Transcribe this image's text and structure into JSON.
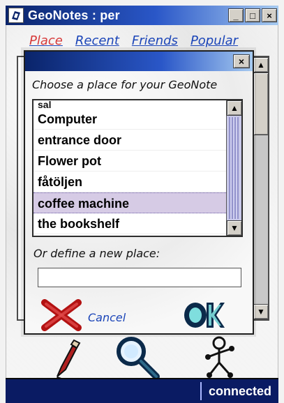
{
  "window": {
    "title": "GeoNotes : per",
    "controls": {
      "minimize": "_",
      "maximize": "□",
      "close": "×"
    }
  },
  "tabs": [
    {
      "label": "Place",
      "active": true
    },
    {
      "label": "Recent",
      "active": false
    },
    {
      "label": "Friends",
      "active": false
    },
    {
      "label": "Popular",
      "active": false
    }
  ],
  "dialog": {
    "close_label": "×",
    "prompt": "Choose a place for your GeoNote",
    "places": [
      {
        "label": "sal",
        "partial": true,
        "selected": false
      },
      {
        "label": "Computer",
        "partial": false,
        "selected": false
      },
      {
        "label": "entrance door",
        "partial": false,
        "selected": false
      },
      {
        "label": "Flower pot",
        "partial": false,
        "selected": false
      },
      {
        "label": "fåtöljen",
        "partial": false,
        "selected": false
      },
      {
        "label": "coffee machine",
        "partial": false,
        "selected": true
      },
      {
        "label": "the bookshelf",
        "partial": false,
        "selected": false
      }
    ],
    "define_label": "Or define a new place:",
    "new_place_value": "",
    "cancel_label": "Cancel",
    "ok_label": "OK"
  },
  "status": {
    "text": "connected"
  },
  "icons": {
    "app": "geonotes-app-icon",
    "pencil": "pencil-icon",
    "search": "magnifier-icon",
    "friends": "stick-figure-icon",
    "cancel": "red-x-icon",
    "ok": "ok-icon"
  },
  "colors": {
    "title_gradient_start": "#0a246a",
    "title_gradient_mid": "#2a57c8",
    "title_gradient_end": "#a6caf0",
    "link_blue": "#1b45b8",
    "tab_active_red": "#d73a3a",
    "status_bg": "#0a1b63",
    "selected_row": "#d6cbe5"
  }
}
